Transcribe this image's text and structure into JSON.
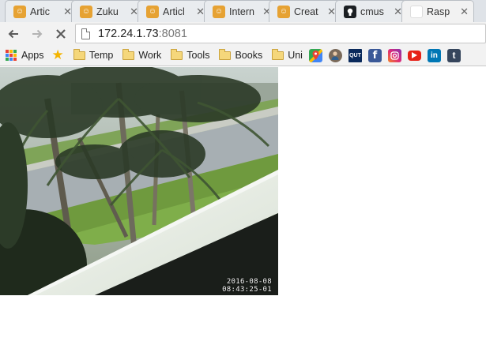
{
  "tabs": [
    {
      "title": "Artic",
      "favicon": "bunny-favicon-icon"
    },
    {
      "title": "Zuku",
      "favicon": "bunny-favicon-icon"
    },
    {
      "title": "Articl",
      "favicon": "bunny-favicon-icon"
    },
    {
      "title": "Intern",
      "favicon": "bunny-favicon-icon"
    },
    {
      "title": "Creat",
      "favicon": "bunny-favicon-icon"
    },
    {
      "title": "cmus",
      "favicon": "github-icon"
    },
    {
      "title": "Rasp",
      "favicon": "google-icon"
    }
  ],
  "toolbar": {
    "back_icon": "arrow-left-icon",
    "forward_icon": "arrow-right-icon",
    "stop_icon": "close-icon",
    "url_host": "172.24.1.73",
    "url_port": ":8081"
  },
  "bookmarks": {
    "apps_label": "Apps",
    "folders": [
      "Temp",
      "Work",
      "Tools",
      "Books",
      "Uni"
    ],
    "shortcut_icons": [
      "google-maps-icon",
      "profile-avatar-icon",
      "qut-icon",
      "facebook-icon",
      "instagram-icon",
      "youtube-icon",
      "linkedin-icon",
      "tumblr-icon"
    ]
  },
  "camera": {
    "date": "2016-08-08",
    "time": "08:43:25-01"
  },
  "colors": {
    "tab_strip": "#dfe3e8",
    "toolbar": "#f2f2f2",
    "facebook": "#3b5998",
    "youtube": "#e62117",
    "linkedin": "#0077b5",
    "tumblr": "#36465d"
  }
}
